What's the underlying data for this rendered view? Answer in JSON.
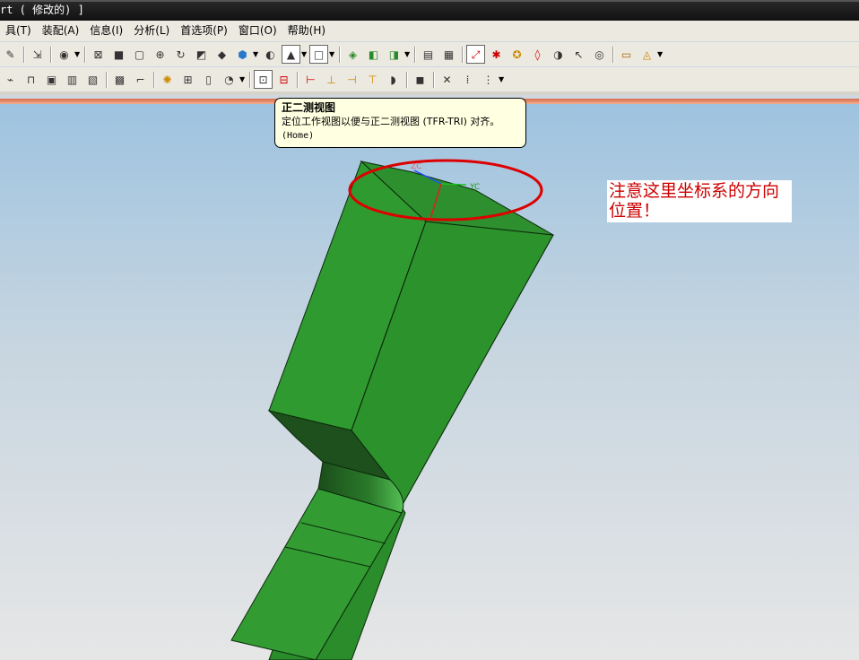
{
  "window": {
    "title": "rt ( 修改的) ]"
  },
  "menu": {
    "items": [
      "具(T)",
      "装配(A)",
      "信息(I)",
      "分析(L)",
      "首选项(P)",
      "窗口(O)",
      "帮助(H)"
    ]
  },
  "toolbar1": {
    "icons": [
      "pen-icon",
      "cursor-icon",
      "eye-icon",
      "fit-icon",
      "zoom-box-icon",
      "pan-icon",
      "zoom-icon",
      "rotate-icon",
      "perspective-icon",
      "orient-view-icon",
      "shaded-cube-icon",
      "render-style-icon",
      "lighting-icon",
      "wire-frame-icon",
      "snap-icon",
      "layer-icon",
      "layer-settings-icon",
      "move-layer-icon",
      "view-section-icon",
      "selection-icon",
      "edit-object-icon",
      "measure-icon",
      "display-icon",
      "hide-icon",
      "show-icon",
      "hide-all-icon",
      "ruler-icon",
      "analysis-icon"
    ]
  },
  "toolbar2": {
    "icons": [
      "feature-icon",
      "assembly-icon",
      "component-icon",
      "constraint-icon",
      "arrange-icon",
      "explode-icon",
      "link-icon",
      "clone-icon",
      "wave-icon",
      "sequence-icon",
      "timer-icon",
      "trimetric-view-icon",
      "isometric-view-icon",
      "front-view-icon",
      "top-view-icon",
      "right-view-icon",
      "bottom-view-icon",
      "left-view-icon",
      "back-view-icon",
      "delete-icon",
      "align-icon",
      "distribute-icon"
    ]
  },
  "tooltip": {
    "title": "正二测视图",
    "description": "定位工作视图以便与正二测视图 (TFR-TRI) 对齐。",
    "shortcut": "(Home)"
  },
  "annotation": {
    "text": "注意这里坐标系的方向位置！",
    "color": "#cc0000"
  },
  "axes": {
    "y_label": "YC",
    "z_label": "ZC"
  },
  "colors": {
    "model_fill": "#2f9a2f",
    "model_dark": "#1e5a1e",
    "model_edge": "#0c2a0c",
    "highlight_circle": "#dd0000"
  }
}
